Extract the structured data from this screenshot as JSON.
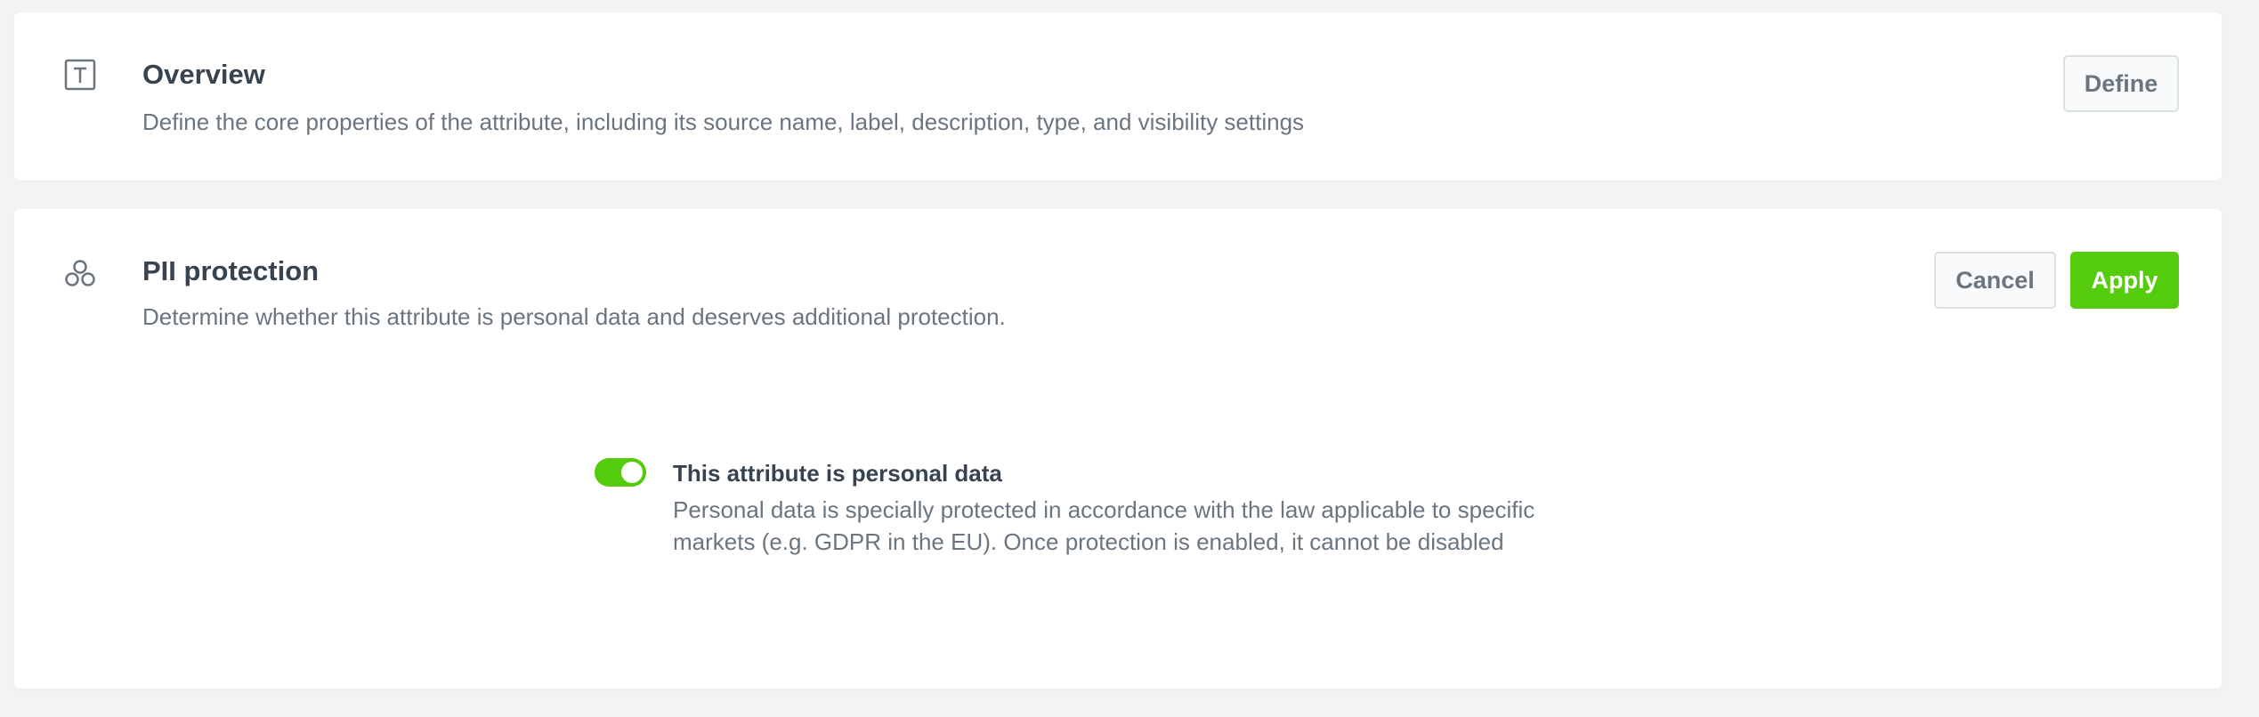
{
  "overview": {
    "icon": "text-icon",
    "title": "Overview",
    "description": "Define the core properties of the attribute, including its source name, label, description, type, and visibility settings",
    "define_label": "Define"
  },
  "pii": {
    "icon": "pii-protection-icon",
    "title": "PII protection",
    "description": "Determine whether this attribute is personal data and deserves additional protection.",
    "cancel_label": "Cancel",
    "apply_label": "Apply",
    "option": {
      "enabled": true,
      "title": "This attribute is personal data",
      "description_line1": "Personal data is specially protected in accordance with the law applicable to specific",
      "description_line2": "markets (e.g. GDPR in the EU). Once protection is enabled, it cannot be disabled"
    }
  },
  "colors": {
    "accent": "#54cb0b",
    "text": "#384350",
    "muted": "#6a7580",
    "background": "#f2f3f5"
  }
}
